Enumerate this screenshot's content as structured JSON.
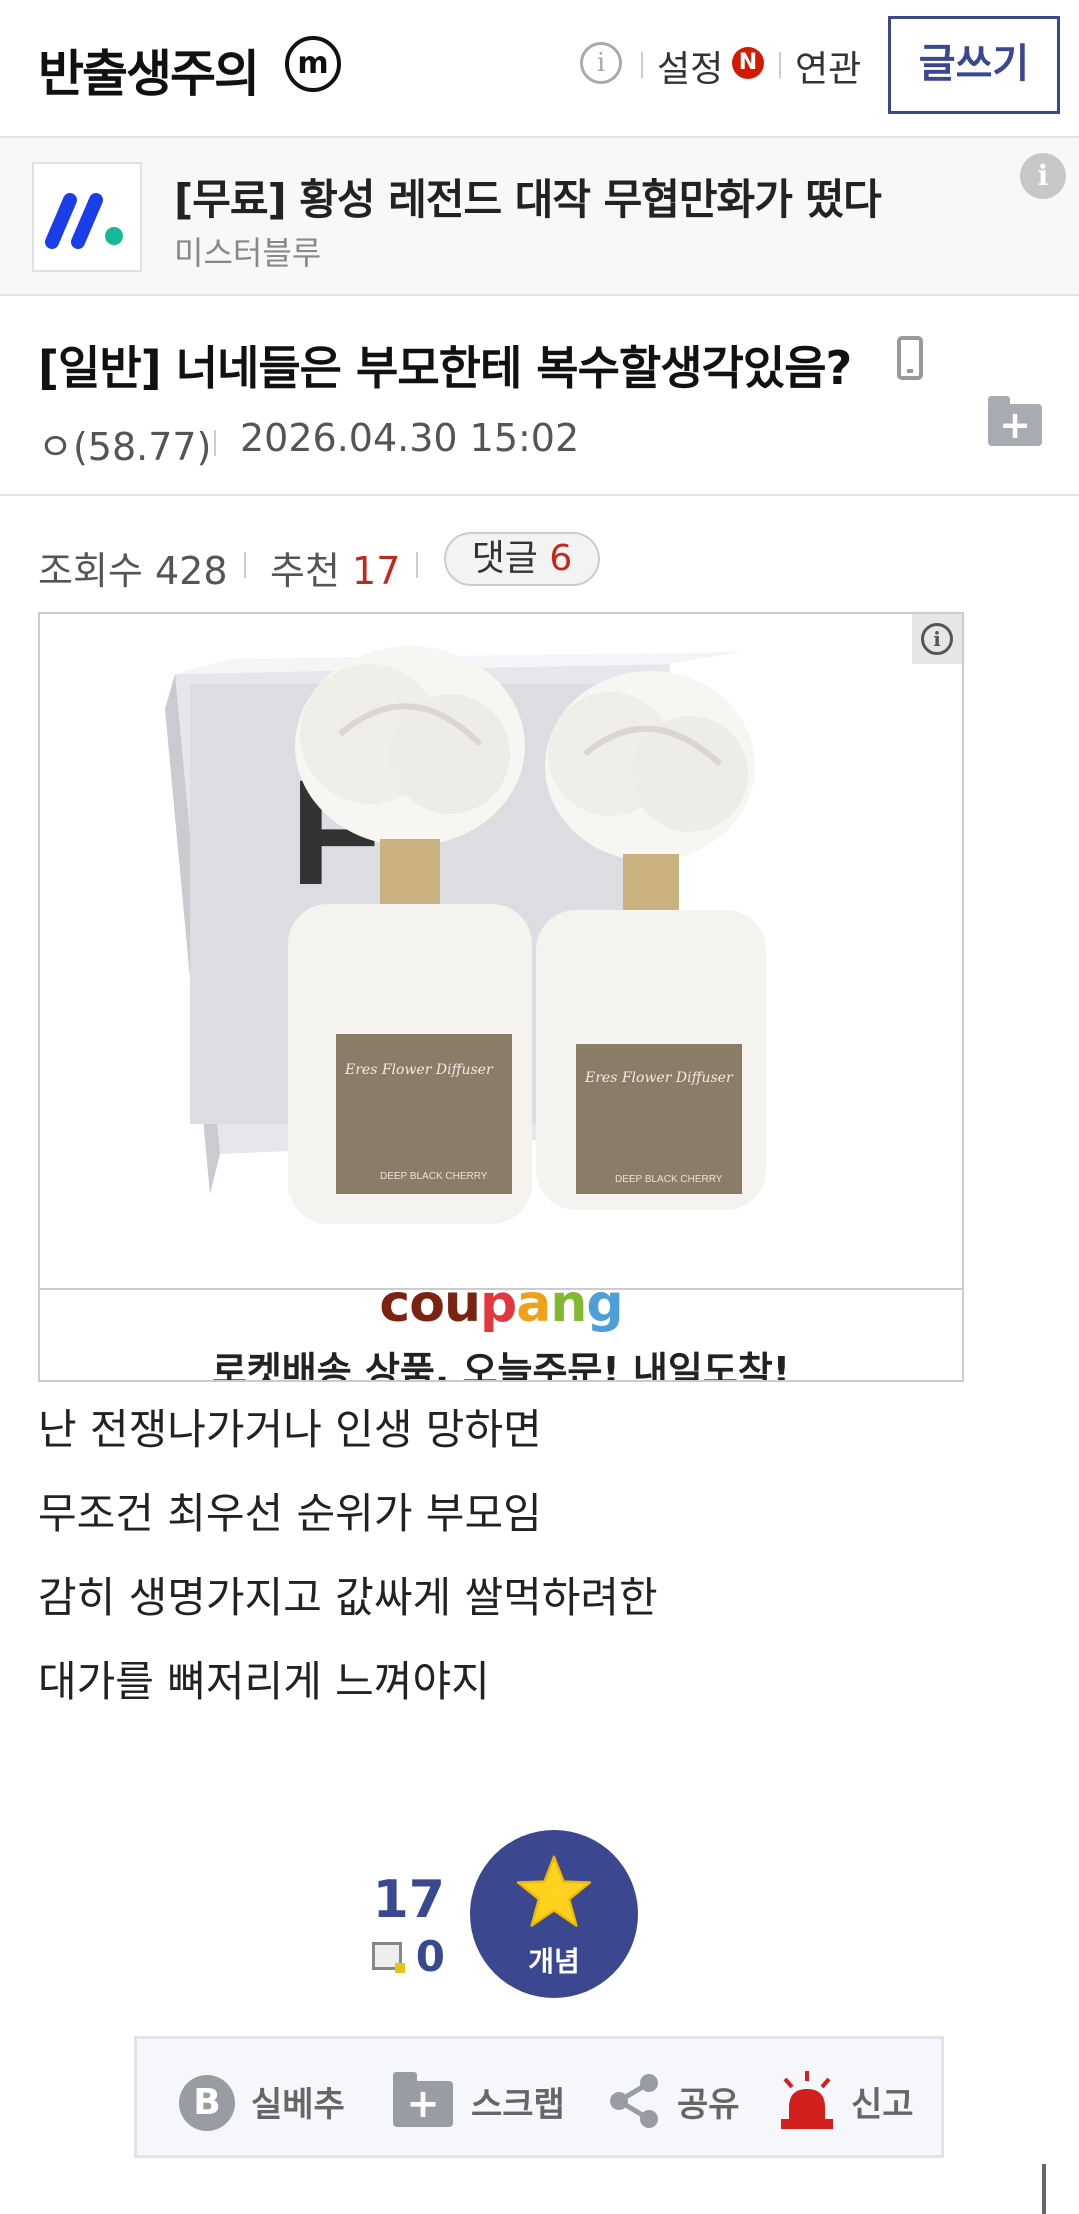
{
  "header": {
    "gallery_title": "반출생주의",
    "minor_icon": "m",
    "info_icon": "i",
    "settings_label": "설정",
    "settings_badge": "N",
    "related_label": "연관",
    "write_label": "글쓰기"
  },
  "sponsor": {
    "title": "[무료] 황성 레전드 대작 무협만화가 떴다",
    "name": "미스터블루",
    "info_icon": "i"
  },
  "post": {
    "title": "[일반] 너네들은 부모한테 복수할생각있음?",
    "writer": "ㅇ(58.77)",
    "date": "2026.04.30 15:02",
    "stats": {
      "views_label": "조회수",
      "views": "428",
      "rec_label": "추천",
      "rec": "17",
      "comment_label": "댓글",
      "comments": "6"
    },
    "body": [
      "난 전쟁나가거나 인생 망하면",
      "무조건 최우선 순위가 부모임",
      "감히 생명가지고 값싸게 쌀먹하려한",
      "대가를 뼈저리게 느껴야지"
    ]
  },
  "ad": {
    "info_icon": "i",
    "brand": [
      "cou",
      "p",
      "a",
      "n",
      "g"
    ],
    "slogan": "로켓배송 상품, 오늘주문! 내일도착!",
    "box_letters": "F",
    "label_text": "Eres Flower Diffuser",
    "label_sub": "DEEP BLACK CHERRY"
  },
  "recommend": {
    "up_count": "17",
    "down_count": "0",
    "concept_label": "개념"
  },
  "actions": {
    "bee_icon": "B",
    "bee_label": "실베추",
    "scrap_label": "스크랩",
    "share_label": "공유",
    "report_label": "신고"
  },
  "colors": {
    "accent": "#3b4890",
    "red": "#c4271b",
    "badge": "#d31900"
  }
}
